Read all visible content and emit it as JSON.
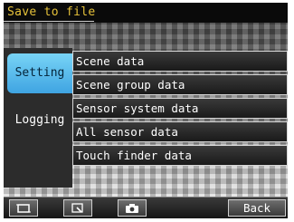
{
  "title": "Save to file",
  "tabs": [
    {
      "label": "Setting",
      "active": true
    },
    {
      "label": "Logging",
      "active": false
    }
  ],
  "menu_items": [
    {
      "label": "Scene data"
    },
    {
      "label": "Scene group data"
    },
    {
      "label": "Sensor system data"
    },
    {
      "label": "All sensor data"
    },
    {
      "label": "Touch finder data"
    }
  ],
  "toolbar": {
    "icons": [
      "frame-icon",
      "zoom-icon",
      "camera-icon"
    ],
    "back_label": "Back"
  },
  "colors": {
    "title_text": "#e6c23a",
    "active_tab": "#4fb3ea",
    "panel": "#2c2c2c"
  }
}
